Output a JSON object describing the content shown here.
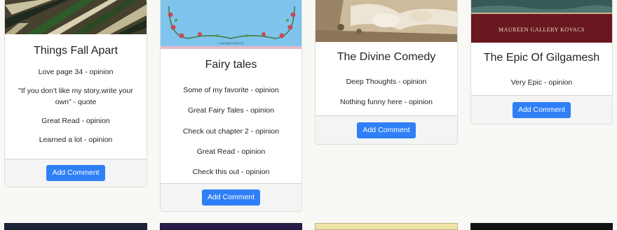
{
  "cards": [
    {
      "title": "Things Fall Apart",
      "comments": [
        "Love page 34 - opinion",
        "\"If you don't like my story,write your own\" - quote",
        "Great Read - opinion",
        "Learned a lot - opinion"
      ],
      "button_label": "Add Comment"
    },
    {
      "title": "Fairy tales",
      "cover_caption": "Copyrighted Material",
      "comments": [
        "Some of my favorite - opinion",
        "Great Fairy Tales - opinion",
        "Check out chapter 2 - opinion",
        "Great Read - opinion",
        "Check this out - opinion"
      ],
      "button_label": "Add Comment"
    },
    {
      "title": "The Divine Comedy",
      "comments": [
        "Deep Thoughts - opinion",
        "Nothing funny here - opinion"
      ],
      "button_label": "Add Comment"
    },
    {
      "title": "The Epic Of Gilgamesh",
      "cover_caption": "MAUREEN GALLERY KOVACS",
      "comments": [
        "Very Epic - opinion"
      ],
      "button_label": "Add Comment"
    }
  ],
  "colors": {
    "page_background": "#f8f8f5",
    "button": "#2f80f7",
    "footer": "#f4f4f4"
  }
}
